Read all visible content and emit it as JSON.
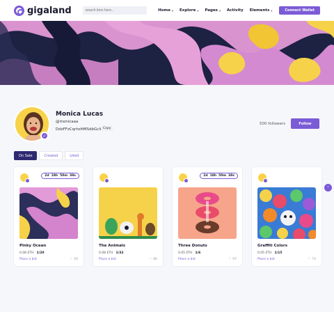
{
  "header": {
    "logo_text": "gigaland",
    "search_placeholder": "search item here...",
    "nav": [
      {
        "label": "Home",
        "dropdown": true
      },
      {
        "label": "Explore",
        "dropdown": true
      },
      {
        "label": "Pages",
        "dropdown": true
      },
      {
        "label": "Activity",
        "dropdown": false
      },
      {
        "label": "Elements",
        "dropdown": true
      }
    ],
    "connect_label": "Connect Wallet"
  },
  "profile": {
    "name": "Monica Lucas",
    "handle": "@monicaaa",
    "address": "DdzFFzCqrhsHMSdbGcW...",
    "copy_label": "Copy",
    "followers": "500 followers",
    "follow_label": "Follow"
  },
  "tabs": [
    {
      "label": "On Sale",
      "active": true
    },
    {
      "label": "Created",
      "active": false
    },
    {
      "label": "Liked",
      "active": false
    }
  ],
  "cards": [
    {
      "title": "Pinky Ocean",
      "price": "0.08 ETH",
      "qty": "1/20",
      "bid": "Place a bid",
      "likes": "50",
      "timer": [
        "2d",
        "18h",
        "50m",
        "38s"
      ]
    },
    {
      "title": "The Animals",
      "price": "0.08 ETH",
      "qty": "1/32",
      "bid": "Place a bid",
      "likes": "80",
      "timer": null
    },
    {
      "title": "Three Donuts",
      "price": "0.05 ETH",
      "qty": "1/6",
      "bid": "Place a bid",
      "likes": "97",
      "timer": [
        "2d",
        "18h",
        "50m",
        "38s"
      ]
    },
    {
      "title": "Graffiti Colors",
      "price": "0.05 ETH",
      "qty": "1/15",
      "bid": "Place a bid",
      "likes": "73",
      "timer": null
    }
  ],
  "colors": {
    "accent": "#7b5bd6",
    "dark": "#2d2a72"
  },
  "icons": {
    "scroll": "chevron-up-icon",
    "verify": "check-icon",
    "like": "heart-icon"
  }
}
